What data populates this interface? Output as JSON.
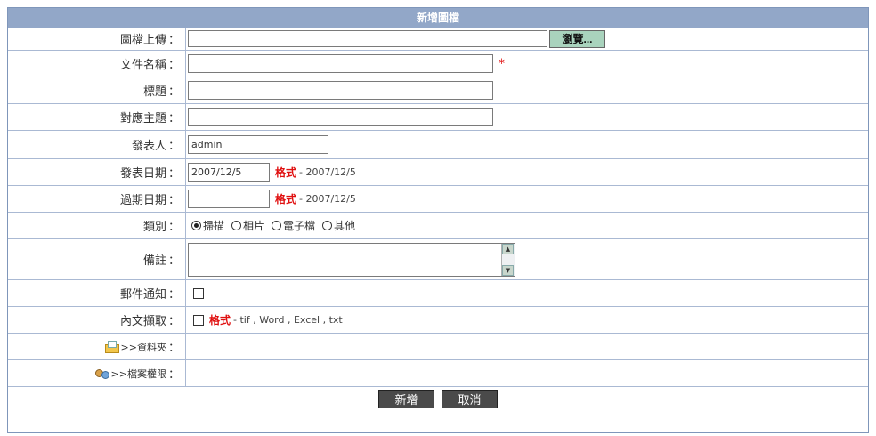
{
  "form": {
    "title": "新增圖檔",
    "upload": {
      "label": "圖檔上傳",
      "value": "",
      "browse_label": "瀏覽..."
    },
    "doc_name": {
      "label": "文件名稱",
      "value": "",
      "required_mark": "*"
    },
    "subject": {
      "label": "標題",
      "value": ""
    },
    "topic": {
      "label": "對應主題",
      "value": ""
    },
    "publisher": {
      "label": "發表人",
      "value": "admin"
    },
    "publish_date": {
      "label": "發表日期",
      "value": "2007/12/5",
      "format_label": "格式",
      "format_value": "- 2007/12/5"
    },
    "expire_date": {
      "label": "過期日期",
      "value": "",
      "format_label": "格式",
      "format_value": "- 2007/12/5"
    },
    "category": {
      "label": "類別",
      "options": [
        "掃描",
        "相片",
        "電子檔",
        "其他"
      ],
      "selected": "掃描"
    },
    "memo": {
      "label": "備註",
      "value": ""
    },
    "mail_notify": {
      "label": "郵件通知",
      "checked": false
    },
    "extract": {
      "label": "內文擷取",
      "checked": false,
      "format_label": "格式",
      "format_value": "- tif , Word , Excel , txt"
    },
    "folder": {
      "label": ">>資料夾",
      "icon": "folder-icon"
    },
    "permission": {
      "label": ">>檔案權限",
      "icon": "permission-icon"
    },
    "colon": "："
  },
  "buttons": {
    "add": "新增",
    "cancel": "取消"
  },
  "colors": {
    "header_bg": "#92a7c8",
    "border": "#aab9d3",
    "required": "#e01010",
    "browse_bg": "#a9d3bd",
    "button_bg": "#4a4a4a"
  }
}
